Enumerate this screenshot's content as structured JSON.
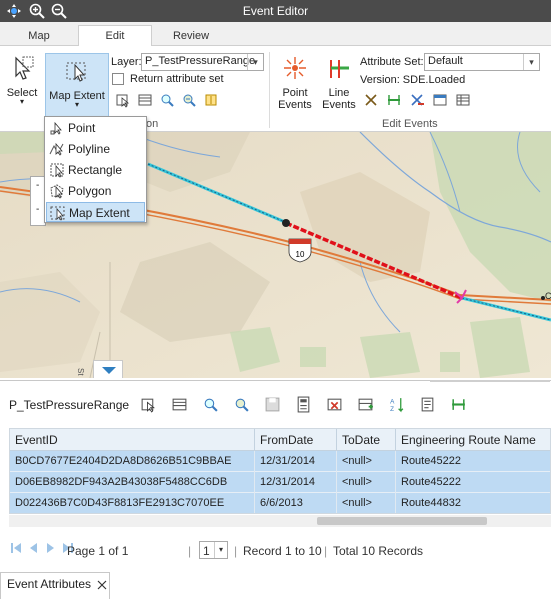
{
  "titlebar": {
    "title": "Event Editor",
    "icons": [
      "move-icon",
      "zoom-in-icon",
      "zoom-out-icon"
    ]
  },
  "tabs": [
    {
      "label": "Map",
      "active": false
    },
    {
      "label": "Edit",
      "active": true
    },
    {
      "label": "Review",
      "active": false
    }
  ],
  "ribbon": {
    "select_label": "Select",
    "map_extent_label": "Map Extent",
    "layer_label": "Layer:",
    "layer_value": "P_TestPressureRange",
    "return_attr_label": "Return attribute set",
    "return_attr_checked": false,
    "group_label_partial": "on",
    "point_events_label1": "Point",
    "point_events_label2": "Events",
    "line_events_label1": "Line",
    "line_events_label2": "Events",
    "attribute_set_label": "Attribute Set:",
    "attribute_set_value": "Default",
    "version_label": "Version: SDE.Loaded",
    "edit_events_label": "Edit Events"
  },
  "dropdown": {
    "items": [
      {
        "label": "Point",
        "icon": "select-point-icon",
        "highlighted": false
      },
      {
        "label": "Polyline",
        "icon": "select-polyline-icon",
        "highlighted": false
      },
      {
        "label": "Rectangle",
        "icon": "select-rectangle-icon",
        "highlighted": false
      },
      {
        "label": "Polygon",
        "icon": "select-polygon-icon",
        "highlighted": false
      },
      {
        "label": "Map Extent",
        "icon": "select-map-extent-icon",
        "highlighted": true
      }
    ]
  },
  "map": {
    "route_shield": "10",
    "label_st": "St",
    "label_c": "C"
  },
  "panel": {
    "layer_name": "P_TestPressureRange",
    "columns": [
      "EventID",
      "FromDate",
      "ToDate",
      "Engineering Route Name"
    ],
    "rows": [
      [
        "B0CD7677E2404D2DA8D8626B51C9BBAE",
        "12/31/2014",
        "<null>",
        "Route45222"
      ],
      [
        "D06EB8982DF943A2B43038F5488CC6DB",
        "12/31/2014",
        "<null>",
        "Route45222"
      ],
      [
        "D022436B7C0D43F8813FE2913C7070EE",
        "6/6/2013",
        "<null>",
        "Route44832"
      ]
    ],
    "pager": {
      "page_text": "Page 1 of 1",
      "page_select": "1",
      "record_text": "Record 1 to 10",
      "total_text": "Total 10 Records"
    },
    "bottom_tab": "Event Attributes"
  },
  "colors": {
    "titlebar": "#4b4b4b",
    "row_selected": "#bedaf3",
    "header": "#e9f1f8",
    "route_dashed": "#e0101a",
    "route_cyan": "#34c6d9"
  }
}
